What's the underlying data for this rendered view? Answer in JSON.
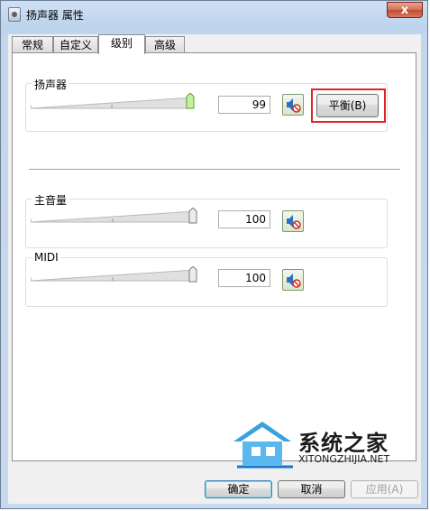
{
  "window": {
    "title": "扬声器 属性",
    "close_symbol": "x"
  },
  "tabs": [
    {
      "label": "常规",
      "active": false
    },
    {
      "label": "自定义",
      "active": false
    },
    {
      "label": "级别",
      "active": true
    },
    {
      "label": "高级",
      "active": false
    }
  ],
  "speaker": {
    "label": "扬声器",
    "level": 99,
    "value": "99",
    "balance_label": "平衡(B)",
    "muted": false
  },
  "master": {
    "label": "主音量",
    "level": 100,
    "value": "100",
    "muted": false
  },
  "midi": {
    "label": "MIDI",
    "level": 100,
    "value": "100",
    "muted": false
  },
  "buttons": {
    "ok": "确定",
    "cancel": "取消",
    "apply": "应用(A)"
  },
  "watermark": {
    "brand": "系统之家",
    "url": "XITONGZHIJIA.NET"
  },
  "colors": {
    "highlight": "#e0242b",
    "accent_green": "#6dbf3e",
    "mute_red": "#d22a1e"
  }
}
